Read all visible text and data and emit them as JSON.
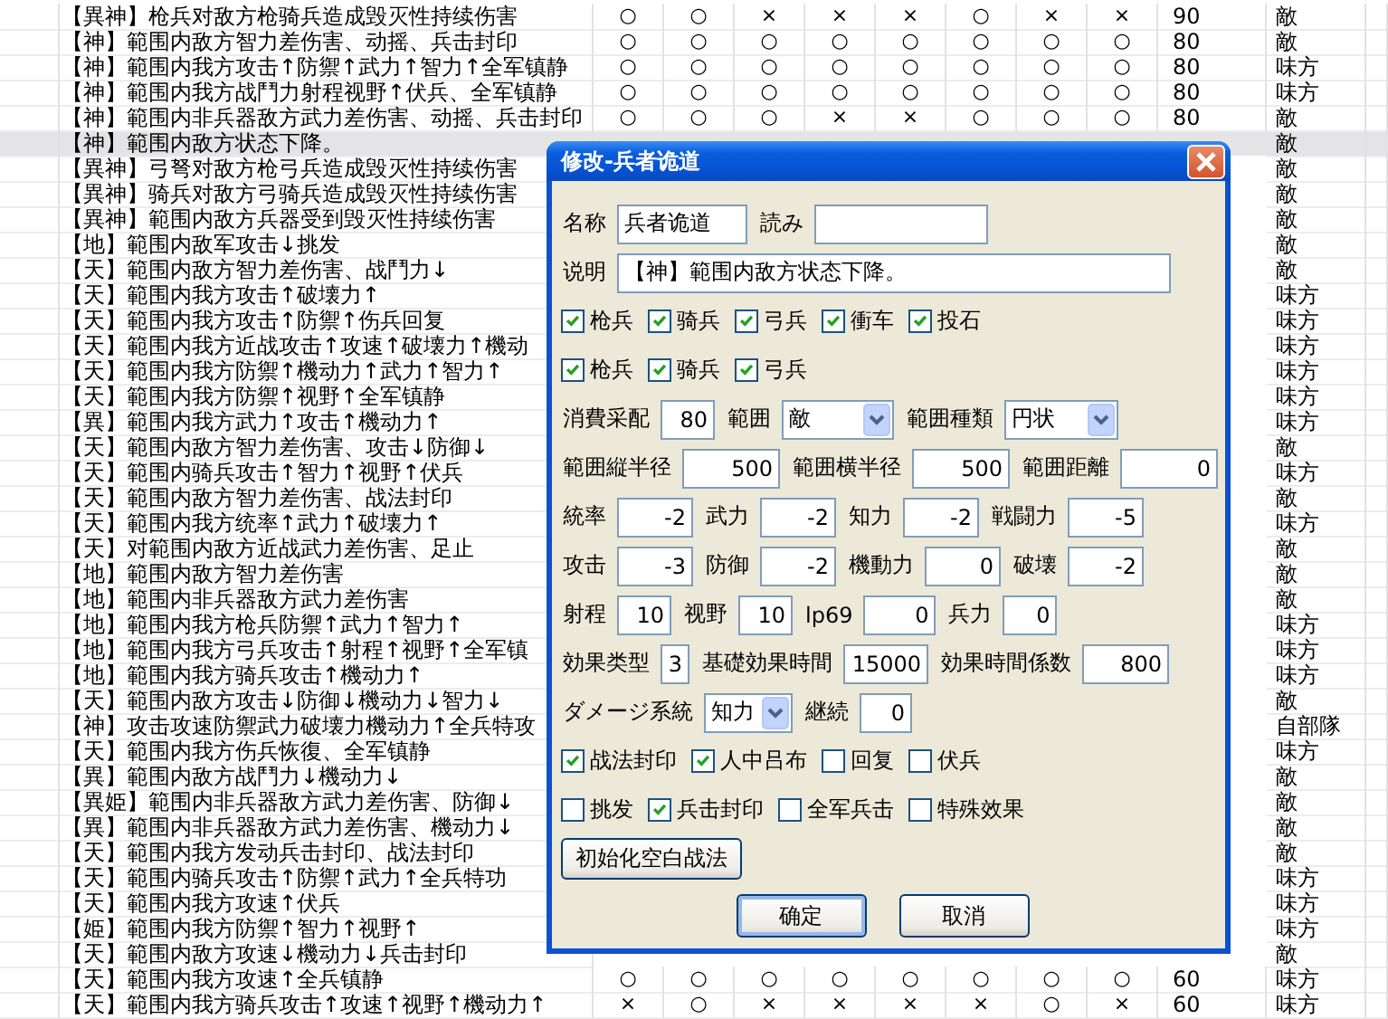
{
  "table": {
    "rows": [
      {
        "description": "【異神】枪兵对敌方枪骑兵造成毁灭性持续伤害",
        "selected": false,
        "marks": [
          "○",
          "○",
          "×",
          "×",
          "×",
          "○",
          "×",
          "×"
        ],
        "cost": "90",
        "side": "敵"
      },
      {
        "description": "【神】範围内敌方智力差伤害、动摇、兵击封印",
        "selected": false,
        "marks": [
          "○",
          "○",
          "○",
          "○",
          "○",
          "○",
          "○",
          "○"
        ],
        "cost": "80",
        "side": "敵"
      },
      {
        "description": "【神】範围内我方攻击↑防禦↑武力↑智力↑全军镇静",
        "selected": false,
        "marks": [
          "○",
          "○",
          "○",
          "○",
          "○",
          "○",
          "○",
          "○"
        ],
        "cost": "80",
        "side": "味方"
      },
      {
        "description": "【神】範围内我方战鬥力射程视野↑伏兵、全军镇静",
        "selected": false,
        "marks": [
          "○",
          "○",
          "○",
          "○",
          "○",
          "○",
          "○",
          "○"
        ],
        "cost": "80",
        "side": "味方"
      },
      {
        "description": "【神】範围内非兵器敌方武力差伤害、动摇、兵击封印",
        "selected": false,
        "marks": [
          "○",
          "○",
          "○",
          "×",
          "×",
          "○",
          "○",
          "○"
        ],
        "cost": "80",
        "side": "敵"
      },
      {
        "description": "【神】範围内敌方状态下降。",
        "selected": true,
        "side": "敵"
      },
      {
        "description": "【異神】弓弩对敌方枪弓兵造成毁灭性持续伤害",
        "selected": false,
        "side": "敵"
      },
      {
        "description": "【異神】骑兵对敌方弓骑兵造成毁灭性持续伤害",
        "selected": false,
        "side": "敵"
      },
      {
        "description": "【異神】範围内敌方兵器受到毁灭性持续伤害",
        "selected": false,
        "side": "敵"
      },
      {
        "description": "【地】範围内敌军攻击↓挑发",
        "selected": false,
        "side": "敵"
      },
      {
        "description": "【天】範围内敌方智力差伤害、战鬥力↓",
        "selected": false,
        "side": "敵"
      },
      {
        "description": "【天】範围内我方攻击↑破壊力↑",
        "selected": false,
        "side": "味方"
      },
      {
        "description": "【天】範围内我方攻击↑防禦↑伤兵回复",
        "selected": false,
        "side": "味方"
      },
      {
        "description": "【天】範围内我方近战攻击↑攻速↑破壊力↑機动",
        "selected": false,
        "side": "味方"
      },
      {
        "description": "【天】範围内我方防禦↑機动力↑武力↑智力↑",
        "selected": false,
        "side": "味方"
      },
      {
        "description": "【天】範围内我方防禦↑视野↑全军镇静",
        "selected": false,
        "side": "味方"
      },
      {
        "description": "【異】範围内我方武力↑攻击↑機动力↑",
        "selected": false,
        "side": "味方"
      },
      {
        "description": "【天】範围内敌方智力差伤害、攻击↓防御↓",
        "selected": false,
        "side": "敵"
      },
      {
        "description": "【天】範围内骑兵攻击↑智力↑视野↑伏兵",
        "selected": false,
        "side": "味方"
      },
      {
        "description": "【天】範围内敌方智力差伤害、战法封印",
        "selected": false,
        "side": "敵"
      },
      {
        "description": "【天】範围内我方统率↑武力↑破壊力↑",
        "selected": false,
        "side": "味方"
      },
      {
        "description": "【天】对範围内敌方近战武力差伤害、足止",
        "selected": false,
        "side": "敵"
      },
      {
        "description": "【地】範围内敌方智力差伤害",
        "selected": false,
        "side": "敵"
      },
      {
        "description": "【地】範围内非兵器敌方武力差伤害",
        "selected": false,
        "side": "敵"
      },
      {
        "description": "【地】範围内我方枪兵防禦↑武力↑智力↑",
        "selected": false,
        "side": "味方"
      },
      {
        "description": "【地】範围内我方弓兵攻击↑射程↑视野↑全军镇",
        "selected": false,
        "side": "味方"
      },
      {
        "description": "【地】範围内我方骑兵攻击↑機动力↑",
        "selected": false,
        "side": "味方"
      },
      {
        "description": "【天】範围内敌方攻击↓防御↓機动力↓智力↓",
        "selected": false,
        "side": "敵"
      },
      {
        "description": "【神】攻击攻速防禦武力破壊力機动力↑全兵特攻",
        "selected": false,
        "side": "自部隊"
      },
      {
        "description": "【天】範围内我方伤兵恢復、全军镇静",
        "selected": false,
        "side": "味方"
      },
      {
        "description": "【異】範围内敌方战鬥力↓機动力↓",
        "selected": false,
        "side": "敵"
      },
      {
        "description": "【異姫】範围内非兵器敌方武力差伤害、防御↓",
        "selected": false,
        "side": "敵"
      },
      {
        "description": "【異】範围内非兵器敌方武力差伤害、機动力↓",
        "selected": false,
        "side": "敵"
      },
      {
        "description": "【天】範围内我方发动兵击封印、战法封印",
        "selected": false,
        "side": "敵"
      },
      {
        "description": "【天】範围内骑兵攻击↑防禦↑武力↑全兵特功",
        "selected": false,
        "side": "味方"
      },
      {
        "description": "【天】範围内我方攻速↑伏兵",
        "selected": false,
        "side": "味方"
      },
      {
        "description": "【姫】範围内我方防禦↑智力↑视野↑",
        "selected": false,
        "side": "味方"
      },
      {
        "description": "【天】範围内敌方攻速↓機动力↓兵击封印",
        "selected": false,
        "side": "敵"
      },
      {
        "description": "【天】範围内我方攻速↑全兵镇静",
        "selected": false,
        "marks": [
          "○",
          "○",
          "○",
          "○",
          "○",
          "○",
          "○",
          "○"
        ],
        "cost": "60",
        "side": "味方"
      },
      {
        "description": "【天】範围内我方骑兵攻击↑攻速↑视野↑機动力↑",
        "selected": false,
        "marks": [
          "×",
          "○",
          "×",
          "×",
          "×",
          "×",
          "○",
          "×"
        ],
        "cost": "60",
        "side": "味方"
      }
    ]
  },
  "dialog": {
    "title": "修改-兵者诡道",
    "rows": [
      {
        "kind": "fields",
        "items": [
          {
            "kind": "text",
            "label": "名称",
            "value": "兵者诡道"
          },
          {
            "kind": "text",
            "label": "読み"
          }
        ]
      },
      {
        "kind": "fields",
        "items": [
          {
            "kind": "text",
            "label": "说明",
            "value": "【神】範围内敌方状态下降。"
          }
        ]
      },
      {
        "kind": "checks",
        "items": [
          {
            "label": "枪兵",
            "checked": true
          },
          {
            "label": "骑兵",
            "checked": true
          },
          {
            "label": "弓兵",
            "checked": true
          },
          {
            "label": "衝车",
            "checked": true
          },
          {
            "label": "投石",
            "checked": true
          }
        ]
      },
      {
        "kind": "checks",
        "items": [
          {
            "label": "枪兵",
            "checked": true
          },
          {
            "label": "骑兵",
            "checked": true
          },
          {
            "label": "弓兵",
            "checked": true
          }
        ]
      },
      {
        "kind": "fields",
        "items": [
          {
            "kind": "number",
            "label": "消費采配",
            "value": "80"
          },
          {
            "kind": "select",
            "label": "範囲",
            "value": "敵"
          },
          {
            "kind": "select",
            "label": "範囲種類",
            "value": "円状"
          }
        ]
      },
      {
        "kind": "fields",
        "items": [
          {
            "kind": "number",
            "label": "範囲縦半径",
            "value": "500"
          },
          {
            "kind": "number",
            "label": "範囲横半径",
            "value": "500"
          },
          {
            "kind": "number",
            "label": "範囲距離",
            "value": "0"
          }
        ]
      },
      {
        "kind": "fields",
        "items": [
          {
            "kind": "number",
            "label": "統率",
            "value": "-2"
          },
          {
            "kind": "number",
            "label": "武力",
            "value": "-2"
          },
          {
            "kind": "number",
            "label": "知力",
            "value": "-2"
          },
          {
            "kind": "number",
            "label": "戦闘力",
            "value": "-5"
          }
        ]
      },
      {
        "kind": "fields",
        "items": [
          {
            "kind": "number",
            "label": "攻击",
            "value": "-3"
          },
          {
            "kind": "number",
            "label": "防御",
            "value": "-2"
          },
          {
            "kind": "number",
            "label": "機動力",
            "value": "0"
          },
          {
            "kind": "number",
            "label": "破壊",
            "value": "-2"
          }
        ]
      },
      {
        "kind": "fields",
        "items": [
          {
            "kind": "number",
            "label": "射程",
            "value": "10"
          },
          {
            "kind": "number",
            "label": "视野",
            "value": "10"
          },
          {
            "kind": "number",
            "label": "lp69",
            "value": "0"
          },
          {
            "kind": "number",
            "label": "兵力",
            "value": "0"
          }
        ]
      },
      {
        "kind": "fields",
        "items": [
          {
            "kind": "number",
            "label": "効果类型",
            "value": "3"
          },
          {
            "kind": "number",
            "label": "基礎効果時間",
            "value": "15000"
          },
          {
            "kind": "number",
            "label": "効果時間係数",
            "value": "800"
          }
        ]
      },
      {
        "kind": "fields",
        "items": [
          {
            "kind": "select",
            "label": "ダメージ系統",
            "value": "知力"
          },
          {
            "kind": "number",
            "label": "継続",
            "value": "0"
          }
        ]
      },
      {
        "kind": "checks",
        "items": [
          {
            "label": "战法封印",
            "checked": true
          },
          {
            "label": "人中吕布",
            "checked": true
          },
          {
            "label": "回复",
            "checked": false
          },
          {
            "label": "伏兵",
            "checked": false
          }
        ]
      },
      {
        "kind": "checks",
        "items": [
          {
            "label": "挑发",
            "checked": false
          },
          {
            "label": "兵击封印",
            "checked": true
          },
          {
            "label": "全军兵击",
            "checked": false
          },
          {
            "label": "特殊效果",
            "checked": false
          }
        ]
      }
    ],
    "reset_button": "初始化空白战法",
    "buttons": [
      {
        "label": "确定",
        "focused": true
      },
      {
        "label": "取消",
        "focused": false
      }
    ]
  }
}
